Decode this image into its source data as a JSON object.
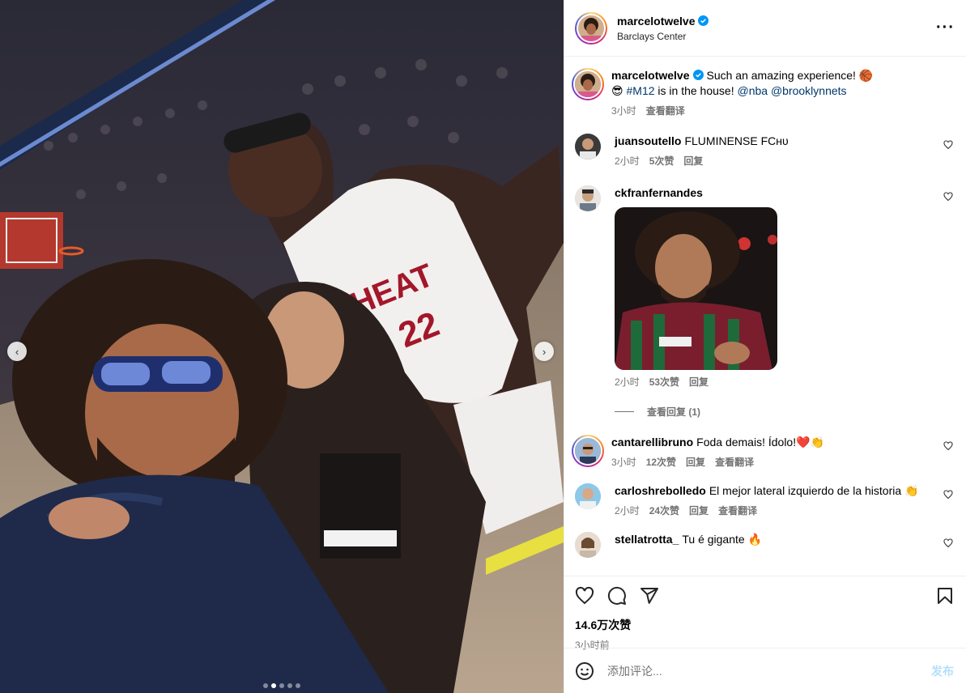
{
  "header": {
    "username": "marcelotwelve",
    "location": "Barclays Center"
  },
  "caption": {
    "username": "marcelotwelve",
    "text_1": "Such an amazing experience! 🏀",
    "text_2_emoji": "😎",
    "hashtag": "#M12",
    "text_2": " is in the house! ",
    "mention_1": "@nba",
    "mention_2": "@brooklynnets",
    "time": "3小时",
    "translate": "查看翻译"
  },
  "comments": [
    {
      "username": "juansoutello",
      "text": "FLUMINENSE FCʜᴜ",
      "time": "2小时",
      "likes": "5次赞",
      "reply": "回复"
    },
    {
      "username": "ckfranfernandes",
      "text": "",
      "time": "2小时",
      "likes": "53次赞",
      "reply": "回复",
      "view_replies": "查看回复 (1)"
    },
    {
      "username": "cantarellibruno",
      "text": "Foda demais! Ídolo!❤️👏",
      "time": "3小时",
      "likes": "12次赞",
      "reply": "回复",
      "translate": "查看翻译"
    },
    {
      "username": "carloshrebolledo",
      "text": "El mejor lateral izquierdo de la historia 👏",
      "time": "2小时",
      "likes": "24次赞",
      "reply": "回复",
      "translate": "查看翻译"
    },
    {
      "username": "stellatrotta_",
      "text": "Tu é gigante 🔥"
    }
  ],
  "footer": {
    "likes": "14.6万次赞",
    "posted": "3小时前",
    "placeholder": "添加评论...",
    "post": "发布"
  },
  "carousel": {
    "count": 5,
    "active": 1
  },
  "colors": {
    "link": "#00376b",
    "verified": "#0095f6",
    "muted": "#737373",
    "post_disabled": "#b2dffc"
  }
}
